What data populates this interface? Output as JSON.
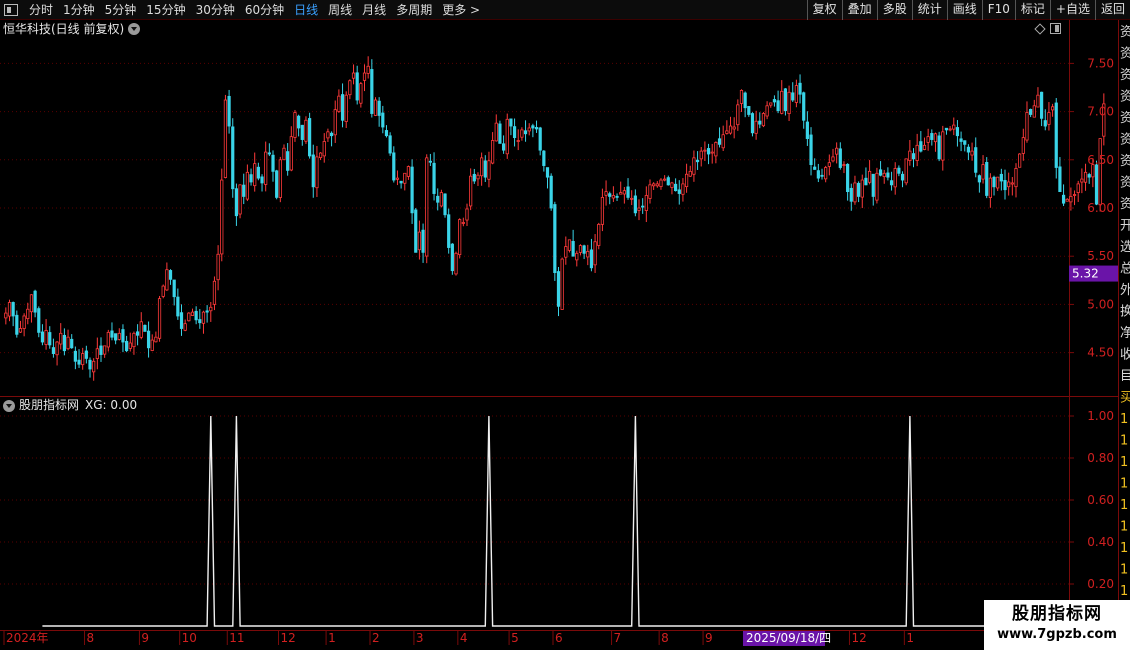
{
  "toolbar": {
    "periods": [
      "分时",
      "1分钟",
      "5分钟",
      "15分钟",
      "30分钟",
      "60分钟",
      "日线",
      "周线",
      "月线",
      "多周期",
      "更多 >"
    ],
    "active_period": "日线",
    "right_buttons": [
      "复权",
      "叠加",
      "多股",
      "统计",
      "画线",
      "F10",
      "标记",
      "+自选",
      "返回"
    ]
  },
  "price_panel": {
    "title": "恒华科技(日线 前复权)",
    "axis_labels": [
      "7.50",
      "7.00",
      "6.50",
      "6.00",
      "5.50",
      "5.00",
      "4.50"
    ],
    "current_price_tag": "5.32"
  },
  "indicator_panel": {
    "title": "股朋指标网",
    "xg_label": "XG: 0.00",
    "axis_labels": [
      "1.00",
      "0.80",
      "0.60",
      "0.40",
      "0.20"
    ]
  },
  "date_axis": {
    "labels": [
      "2024年",
      "8",
      "9",
      "10",
      "11",
      "12",
      "1",
      "2",
      "3",
      "4",
      "5",
      "6",
      "7",
      "8",
      "9",
      "12",
      "1"
    ],
    "cursor_date": "2025/09/18/四"
  },
  "side_panel": {
    "chars": [
      "资",
      "资",
      "资",
      "资",
      "资",
      "资",
      "资",
      "资",
      "资",
      "开",
      "选",
      "总",
      "外",
      "换",
      "净",
      "收",
      "目",
      "买",
      "1",
      "1",
      "1",
      "1",
      "1",
      "1",
      "1",
      "1",
      "1"
    ]
  },
  "watermark": {
    "title": "股朋指标网",
    "url": "www.7gpzb.com"
  },
  "chart_data": {
    "type": "candlestick",
    "title": "恒华科技(日线 前复权)",
    "y_axis_ticks": [
      4.5,
      5.0,
      5.5,
      6.0,
      6.5,
      7.0,
      7.5
    ],
    "ylim": [
      4.05,
      7.95
    ],
    "series": [
      {
        "name": "close",
        "values": [
          4.91,
          5.02,
          4.88,
          4.69,
          4.75,
          4.88,
          4.95,
          5.1,
          4.92,
          4.71,
          4.61,
          4.73,
          4.58,
          4.49,
          4.61,
          4.7,
          4.52,
          4.66,
          4.55,
          4.41,
          4.38,
          4.49,
          4.44,
          4.33,
          4.41,
          4.54,
          4.48,
          4.57,
          4.71,
          4.66,
          4.63,
          4.7,
          4.61,
          4.52,
          4.6,
          4.7,
          4.68,
          4.82,
          4.72,
          4.55,
          4.63,
          4.66,
          5.06,
          5.19,
          5.36,
          5.26,
          5.08,
          4.88,
          4.75,
          4.8,
          4.91,
          4.92,
          4.84,
          4.81,
          4.92,
          4.92,
          4.97,
          5.24,
          5.52,
          6.29,
          7.12,
          6.85,
          6.2,
          5.92,
          6.24,
          6.12,
          6.37,
          6.27,
          6.46,
          6.31,
          6.26,
          6.58,
          6.56,
          6.38,
          6.11,
          6.5,
          6.62,
          6.39,
          6.74,
          6.99,
          6.83,
          6.71,
          6.91,
          6.54,
          6.22,
          6.53,
          6.57,
          6.69,
          6.79,
          6.75,
          7.02,
          7.16,
          6.91,
          7.17,
          7.32,
          7.4,
          7.12,
          7.29,
          7.4,
          7.47,
          6.98,
          7.12,
          6.96,
          6.84,
          6.75,
          6.57,
          6.29,
          6.31,
          6.26,
          6.36,
          6.43,
          5.95,
          5.54,
          5.75,
          5.54,
          6.52,
          6.48,
          6.15,
          6.06,
          6.16,
          5.93,
          5.59,
          5.35,
          5.53,
          5.88,
          5.85,
          5.99,
          6.33,
          6.28,
          6.34,
          6.52,
          6.32,
          6.49,
          6.7,
          6.88,
          6.67,
          6.6,
          6.92,
          6.85,
          6.73,
          6.7,
          6.81,
          6.77,
          6.83,
          6.83,
          6.82,
          6.6,
          6.44,
          6.32,
          6.0,
          5.33,
          4.98,
          5.47,
          5.6,
          5.67,
          5.5,
          5.53,
          5.61,
          5.53,
          5.55,
          5.38,
          5.65,
          5.83,
          6.11,
          6.17,
          6.12,
          6.13,
          6.11,
          6.16,
          6.18,
          6.11,
          6.1,
          5.95,
          6.0,
          6.01,
          6.13,
          6.24,
          6.25,
          6.25,
          6.29,
          6.3,
          6.24,
          6.26,
          6.18,
          6.15,
          6.25,
          6.35,
          6.38,
          6.52,
          6.48,
          6.59,
          6.6,
          6.56,
          6.58,
          6.68,
          6.66,
          6.76,
          6.8,
          6.85,
          6.84,
          7.07,
          7.22,
          7.04,
          6.97,
          6.78,
          6.9,
          6.87,
          6.98,
          7.06,
          7.09,
          7.1,
          7.01,
          7.21,
          7.01,
          7.2,
          7.12,
          7.27,
          7.18,
          6.91,
          6.72,
          6.45,
          6.4,
          6.31,
          6.33,
          6.42,
          6.47,
          6.53,
          6.62,
          6.42,
          6.45,
          6.17,
          6.07,
          6.26,
          6.12,
          6.29,
          6.24,
          6.38,
          6.12,
          6.36,
          6.34,
          6.36,
          6.32,
          6.24,
          6.41,
          6.36,
          6.29,
          6.51,
          6.59,
          6.51,
          6.65,
          6.59,
          6.65,
          6.74,
          6.71,
          6.77,
          6.51,
          6.79,
          6.81,
          6.82,
          6.86,
          6.75,
          6.69,
          6.66,
          6.58,
          6.59,
          6.37,
          6.27,
          6.45,
          6.13,
          6.31,
          6.22,
          6.32,
          6.28,
          6.19,
          6.27,
          6.26,
          6.41,
          6.56,
          6.73,
          6.99,
          6.97,
          7.06,
          7.17,
          6.93,
          6.85,
          6.99,
          7.05,
          6.42,
          6.17,
          6.05,
          6.09,
          6.12,
          6.14,
          6.25,
          6.3,
          6.37,
          6.32,
          6.45,
          6.04,
          6.72,
          7.08
        ]
      }
    ],
    "indicator": {
      "name": "XG",
      "ylim": [
        0,
        1
      ],
      "y_axis_ticks": [
        0.2,
        0.4,
        0.6,
        0.8,
        1.0
      ],
      "signal_indices": [
        56,
        63,
        132,
        172,
        247
      ],
      "bar_count": 290
    }
  }
}
